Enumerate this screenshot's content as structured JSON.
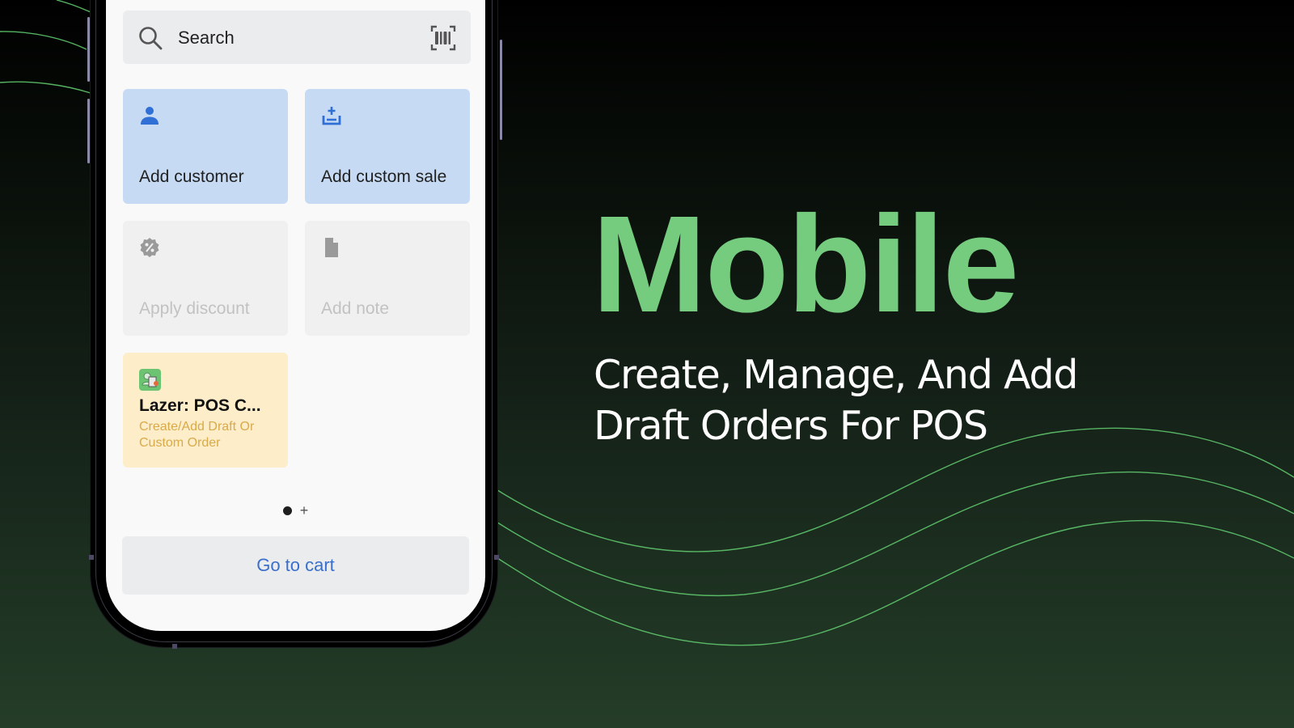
{
  "headline": {
    "title": "Mobile",
    "subtitle_line1": "Create, Manage, And Add",
    "subtitle_line2": "Draft Orders For POS"
  },
  "colors": {
    "accent_green": "#75cc7f",
    "tile_blue": "#c6dbf3",
    "tile_grey": "#f0f0f0",
    "tile_yellow": "#fdedc9",
    "link_blue": "#3a6fcc",
    "app_subtitle": "#d9aa49"
  },
  "phone": {
    "search": {
      "placeholder": "Search",
      "icon": "search-icon",
      "scan_icon": "barcode-scan-icon"
    },
    "tiles": [
      {
        "label": "Add customer",
        "icon": "person-icon",
        "state": "enabled"
      },
      {
        "label": "Add custom sale",
        "icon": "tray-add-icon",
        "state": "enabled"
      },
      {
        "label": "Apply discount",
        "icon": "discount-badge-icon",
        "state": "disabled"
      },
      {
        "label": "Add note",
        "icon": "document-icon",
        "state": "disabled"
      }
    ],
    "app_tile": {
      "title": "Lazer: POS C...",
      "subtitle": "Create/Add Draft Or Custom Order",
      "icon": "lazer-app-logo"
    },
    "pager": {
      "pages": 1,
      "current": 1,
      "add_symbol": "+"
    },
    "cart_button": "Go to cart"
  }
}
